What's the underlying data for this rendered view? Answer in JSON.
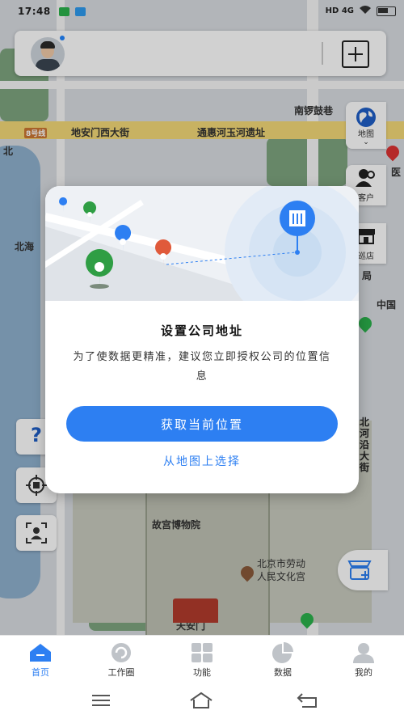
{
  "status_bar": {
    "time": "17:48",
    "network": "HD 4G",
    "colors": {
      "notification_green": "#2bb24c",
      "notification_blue": "#2e9bf0"
    }
  },
  "map": {
    "labels": {
      "street_top": "地安门西大街",
      "street_road": "通惠河玉河遗址",
      "nanluogu": "南锣鼓巷",
      "north_sea": "北海",
      "palace_museum": "故宫博物院",
      "culture_palace_line1": "北京市劳动",
      "culture_palace_line2": "人民文化宫",
      "tiananmen": "天安门",
      "road_badge": "8号线",
      "north_left": "北",
      "street_right": "北河沿大街",
      "china": "中国",
      "bureau": "局",
      "yi": "医"
    },
    "colors": {
      "road": "#f5d978",
      "water": "#8fb1cf",
      "park": "#7ea57f",
      "palace": "#c8cbbf"
    }
  },
  "top_bar": {
    "avatar_icon": "user-avatar-icon",
    "add_icon": "plus-square-icon"
  },
  "side_buttons": [
    {
      "label": "地图",
      "icon": "globe-icon"
    },
    {
      "label": "客户",
      "icon": "customer-icon"
    },
    {
      "label": "巡店",
      "icon": "store-icon"
    }
  ],
  "tool_buttons": [
    {
      "icon": "help-icon"
    },
    {
      "icon": "locate-icon"
    },
    {
      "icon": "frame-icon"
    }
  ],
  "dialog": {
    "title": "设置公司地址",
    "message": "为了使数据更精准，建议您立即授权公司的位置信息",
    "primary_button": "获取当前位置",
    "secondary_link": "从地图上选择",
    "colors": {
      "accent": "#2d7ff2"
    }
  },
  "tabs": [
    {
      "label": "首页",
      "icon": "home-icon",
      "active": true
    },
    {
      "label": "工作圈",
      "icon": "work-circle-icon",
      "active": false
    },
    {
      "label": "功能",
      "icon": "grid-icon",
      "active": false
    },
    {
      "label": "数据",
      "icon": "pie-chart-icon",
      "active": false
    },
    {
      "label": "我的",
      "icon": "profile-icon",
      "active": false
    }
  ],
  "system_nav": {
    "menu_icon": "menu-icon",
    "home_icon": "home-outline-icon",
    "back_icon": "back-icon"
  }
}
